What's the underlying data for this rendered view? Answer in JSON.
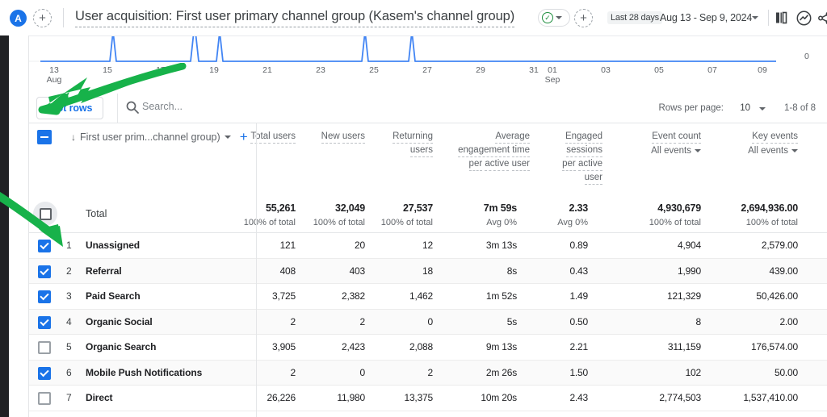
{
  "header": {
    "avatar_letter": "A",
    "add_icon": "plus-icon",
    "title": "User acquisition: First user primary channel group (Kasem's channel group)",
    "verified_icon": "check-circle-icon",
    "verified_caret": "chevron-down-icon",
    "add_comparison_icon": "plus-icon",
    "date_chip": "Last 28 days",
    "date_range": "Aug 13 - Sep 9, 2024",
    "date_caret": "chevron-down-icon",
    "compare_icon": "compare-icon",
    "insights_icon": "insights-icon",
    "share_icon": "share-icon"
  },
  "chart": {
    "y_zero_label": "0",
    "x_ticks": [
      {
        "label": "13",
        "sub": "Aug"
      },
      {
        "label": "15",
        "sub": ""
      },
      {
        "label": "17",
        "sub": ""
      },
      {
        "label": "19",
        "sub": ""
      },
      {
        "label": "21",
        "sub": ""
      },
      {
        "label": "23",
        "sub": ""
      },
      {
        "label": "25",
        "sub": ""
      },
      {
        "label": "27",
        "sub": ""
      },
      {
        "label": "29",
        "sub": ""
      },
      {
        "label": "31",
        "sub": ""
      },
      {
        "label": "01",
        "sub": "Sep"
      },
      {
        "label": "03",
        "sub": ""
      },
      {
        "label": "05",
        "sub": ""
      },
      {
        "label": "07",
        "sub": ""
      },
      {
        "label": "09",
        "sub": ""
      }
    ]
  },
  "toolbar": {
    "plot_rows_label": "Plot rows",
    "search_icon": "search-icon",
    "search_value": "",
    "search_placeholder": "Search...",
    "rows_per_page_label": "Rows per page:",
    "rows_per_page_value": "10",
    "rows_caret": "chevron-down-icon",
    "range_label": "1-8 of 8"
  },
  "table": {
    "select_all_icon": "indeterminate-checkbox-icon",
    "dimension": {
      "sort_icon": "sort-descending-icon",
      "label": "First user prim...channel group)",
      "caret": "chevron-down-icon",
      "add_icon": "plus-icon"
    },
    "columns": [
      {
        "title": "Total users",
        "sub": ""
      },
      {
        "title": "New users",
        "sub": ""
      },
      {
        "title": "Returning users",
        "sub": ""
      },
      {
        "title": "Average engagement time per active user",
        "sub": ""
      },
      {
        "title": "Engaged sessions per active user",
        "sub": ""
      },
      {
        "title": "Event count",
        "sub": "All events"
      },
      {
        "title": "Key events",
        "sub": "All events"
      }
    ],
    "total_row": {
      "label": "Total",
      "checked": false,
      "values": [
        "55,261",
        "32,049",
        "27,537",
        "7m 59s",
        "2.33",
        "4,930,679",
        "2,694,936.00"
      ],
      "subs": [
        "100% of total",
        "100% of total",
        "100% of total",
        "Avg 0%",
        "Avg 0%",
        "100% of total",
        "100% of total"
      ]
    },
    "rows": [
      {
        "index": "1",
        "checked": true,
        "name": "Unassigned",
        "values": [
          "121",
          "20",
          "12",
          "3m 13s",
          "0.89",
          "4,904",
          "2,579.00"
        ]
      },
      {
        "index": "2",
        "checked": true,
        "name": "Referral",
        "values": [
          "408",
          "403",
          "18",
          "8s",
          "0.43",
          "1,990",
          "439.00"
        ]
      },
      {
        "index": "3",
        "checked": true,
        "name": "Paid Search",
        "values": [
          "3,725",
          "2,382",
          "1,462",
          "1m 52s",
          "1.49",
          "121,329",
          "50,426.00"
        ]
      },
      {
        "index": "4",
        "checked": true,
        "name": "Organic Social",
        "values": [
          "2",
          "2",
          "0",
          "5s",
          "0.50",
          "8",
          "2.00"
        ]
      },
      {
        "index": "5",
        "checked": false,
        "name": "Organic Search",
        "values": [
          "3,905",
          "2,423",
          "2,088",
          "9m 13s",
          "2.21",
          "311,159",
          "176,574.00"
        ]
      },
      {
        "index": "6",
        "checked": true,
        "name": "Mobile Push Notifications",
        "values": [
          "2",
          "0",
          "2",
          "2m 26s",
          "1.50",
          "102",
          "50.00"
        ]
      },
      {
        "index": "7",
        "checked": false,
        "name": "Direct",
        "values": [
          "26,226",
          "11,980",
          "13,375",
          "10m 20s",
          "2.43",
          "2,774,503",
          "1,537,410.00"
        ]
      }
    ]
  },
  "annotations": {
    "arrow_color": "#17b24a",
    "arrow_plot_rows": "arrow-pointing-to-plot-rows",
    "arrow_checkbox": "arrow-pointing-to-row-checkbox"
  }
}
